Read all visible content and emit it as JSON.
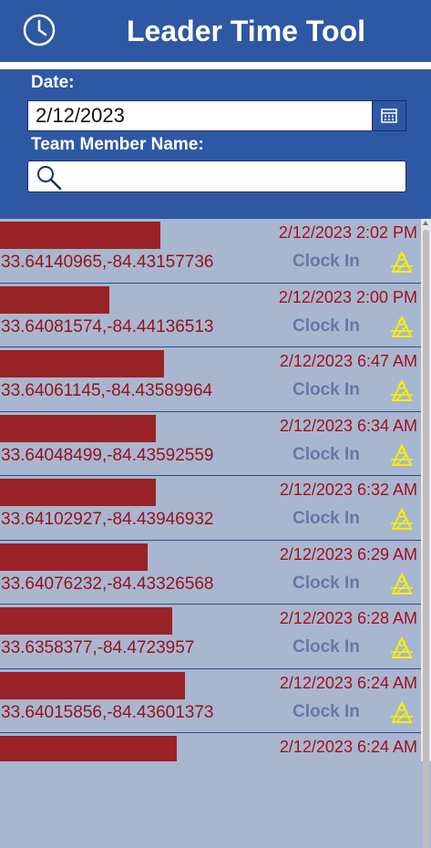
{
  "header": {
    "title": "Leader Time Tool",
    "icon": "clock-icon"
  },
  "filters": {
    "date_label": "Date:",
    "date_value": "2/12/2023",
    "name_label": "Team Member Name:",
    "search_placeholder": "",
    "search_value": ""
  },
  "colors": {
    "header_bg": "#2f58a4",
    "list_bg": "#a9b6cf",
    "name_redaction": "#992226",
    "datetime_text": "#a0121a",
    "action_text": "#6379a6",
    "map_icon": "#f5f000"
  },
  "entries": [
    {
      "datetime": "2/12/2023 2:02 PM",
      "coords": "33.64140965,-84.43157736",
      "action": "Clock In",
      "name_fill": 0.38
    },
    {
      "datetime": "2/12/2023 2:00 PM",
      "coords": "33.64081574,-84.44136513",
      "action": "Clock In",
      "name_fill": 0.26
    },
    {
      "datetime": "2/12/2023 6:47 AM",
      "coords": "33.64061145,-84.43589964",
      "action": "Clock In",
      "name_fill": 0.39
    },
    {
      "datetime": "2/12/2023 6:34 AM",
      "coords": "33.64048499,-84.43592559",
      "action": "Clock In",
      "name_fill": 0.37
    },
    {
      "datetime": "2/12/2023 6:32 AM",
      "coords": "33.64102927,-84.43946932",
      "action": "Clock In",
      "name_fill": 0.37
    },
    {
      "datetime": "2/12/2023 6:29 AM",
      "coords": "33.64076232,-84.43326568",
      "action": "Clock In",
      "name_fill": 0.35
    },
    {
      "datetime": "2/12/2023 6:28 AM",
      "coords": "33.6358377,-84.4723957",
      "action": "Clock In",
      "name_fill": 0.41
    },
    {
      "datetime": "2/12/2023 6:24 AM",
      "coords": "33.64015856,-84.43601373",
      "action": "Clock In",
      "name_fill": 0.44
    },
    {
      "datetime": "2/12/2023 6:24 AM",
      "coords": "",
      "action": "",
      "name_fill": 0.42
    }
  ]
}
